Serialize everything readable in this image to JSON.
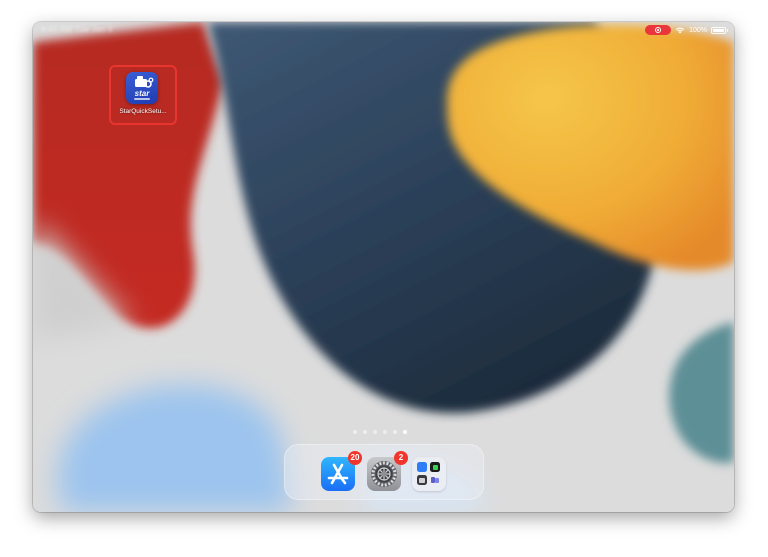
{
  "status_bar": {
    "time": "9:41 AM Tue Jan 9",
    "battery_percent": "100%"
  },
  "home_screen": {
    "apps": [
      {
        "label": "StarQuickSetu...",
        "icon": "star-quick-setup-icon",
        "highlighted": true
      }
    ],
    "page_count": 6,
    "current_page": 6
  },
  "dock": {
    "apps": [
      {
        "name": "App Store",
        "icon": "app-store-icon",
        "badge": "20"
      },
      {
        "name": "Settings",
        "icon": "settings-gear-icon",
        "badge": "2"
      },
      {
        "name": "Folder",
        "icon": "app-folder-icon",
        "badge": ""
      }
    ]
  },
  "colors": {
    "highlight": "#e8352e",
    "badge": "#f0352c",
    "wallpaper_red": "#c0261e",
    "wallpaper_navy": "#2d4660",
    "wallpaper_yellow": "#f2b63a",
    "wallpaper_blue": "#8fb9e8"
  }
}
